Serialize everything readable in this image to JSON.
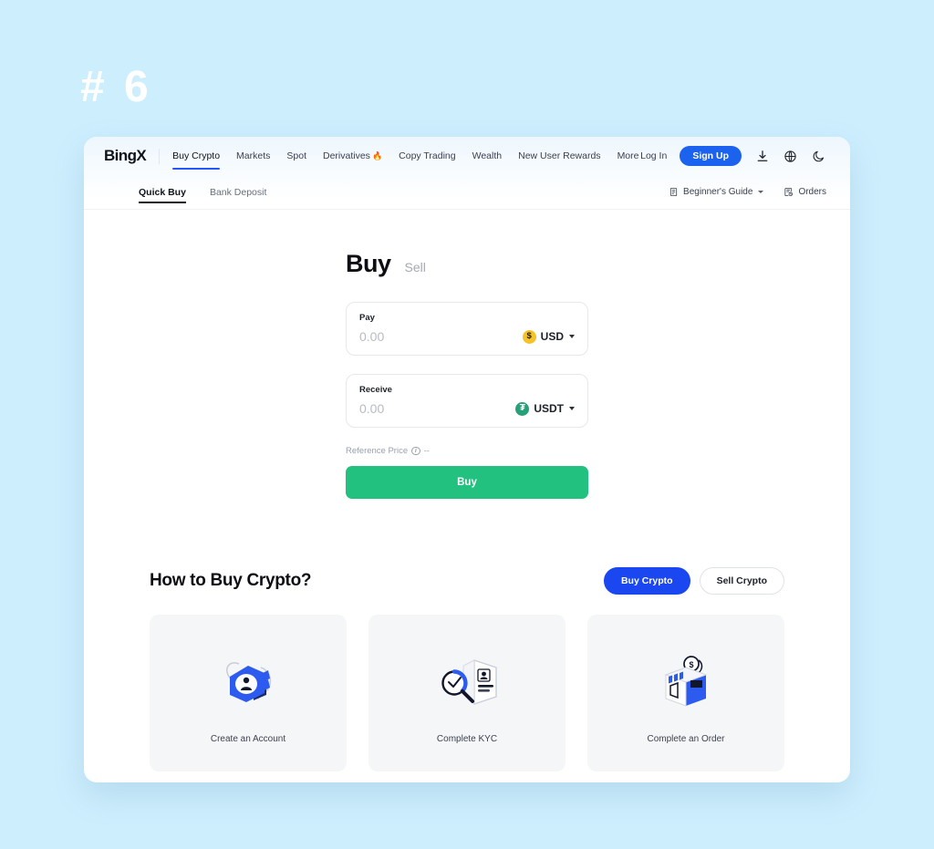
{
  "poster": {
    "number": "# 6"
  },
  "header": {
    "logo": "BingX",
    "nav": [
      {
        "label": "Buy Crypto",
        "active": true,
        "badge": ""
      },
      {
        "label": "Markets",
        "active": false,
        "badge": ""
      },
      {
        "label": "Spot",
        "active": false,
        "badge": ""
      },
      {
        "label": "Derivatives",
        "active": false,
        "badge": "🔥"
      },
      {
        "label": "Copy Trading",
        "active": false,
        "badge": ""
      },
      {
        "label": "Wealth",
        "active": false,
        "badge": ""
      },
      {
        "label": "New User Rewards",
        "active": false,
        "badge": ""
      },
      {
        "label": "More",
        "active": false,
        "badge": ""
      }
    ],
    "login_label": "Log In",
    "signup_label": "Sign Up",
    "icons": [
      "download-icon",
      "globe-icon",
      "moon-icon"
    ]
  },
  "subnav": {
    "tabs": [
      {
        "label": "Quick Buy",
        "active": true
      },
      {
        "label": "Bank Deposit",
        "active": false
      }
    ],
    "beginners_guide": "Beginner's Guide",
    "orders": "Orders"
  },
  "trade": {
    "tab_buy": "Buy",
    "tab_sell": "Sell",
    "pay": {
      "label": "Pay",
      "value": "",
      "placeholder": "0.00",
      "asset": "USD",
      "asset_icon": "usd-coin-icon",
      "asset_color": "#f5c328"
    },
    "receive": {
      "label": "Receive",
      "value": "",
      "placeholder": "0.00",
      "asset": "USDT",
      "asset_icon": "usdt-coin-icon",
      "asset_color": "#25a17a"
    },
    "reference_price_label": "Reference Price",
    "reference_price_value": "--",
    "submit_label": "Buy",
    "submit_color": "#22c180"
  },
  "howto": {
    "title": "How to Buy Crypto?",
    "toggle": [
      {
        "label": "Buy Crypto",
        "active": true
      },
      {
        "label": "Sell Crypto",
        "active": false
      }
    ],
    "steps": [
      {
        "label": "Create an Account",
        "art": "account-badge-illustration"
      },
      {
        "label": "Complete KYC",
        "art": "kyc-magnifier-id-illustration"
      },
      {
        "label": "Complete an Order",
        "art": "order-shop-box-illustration"
      }
    ]
  }
}
